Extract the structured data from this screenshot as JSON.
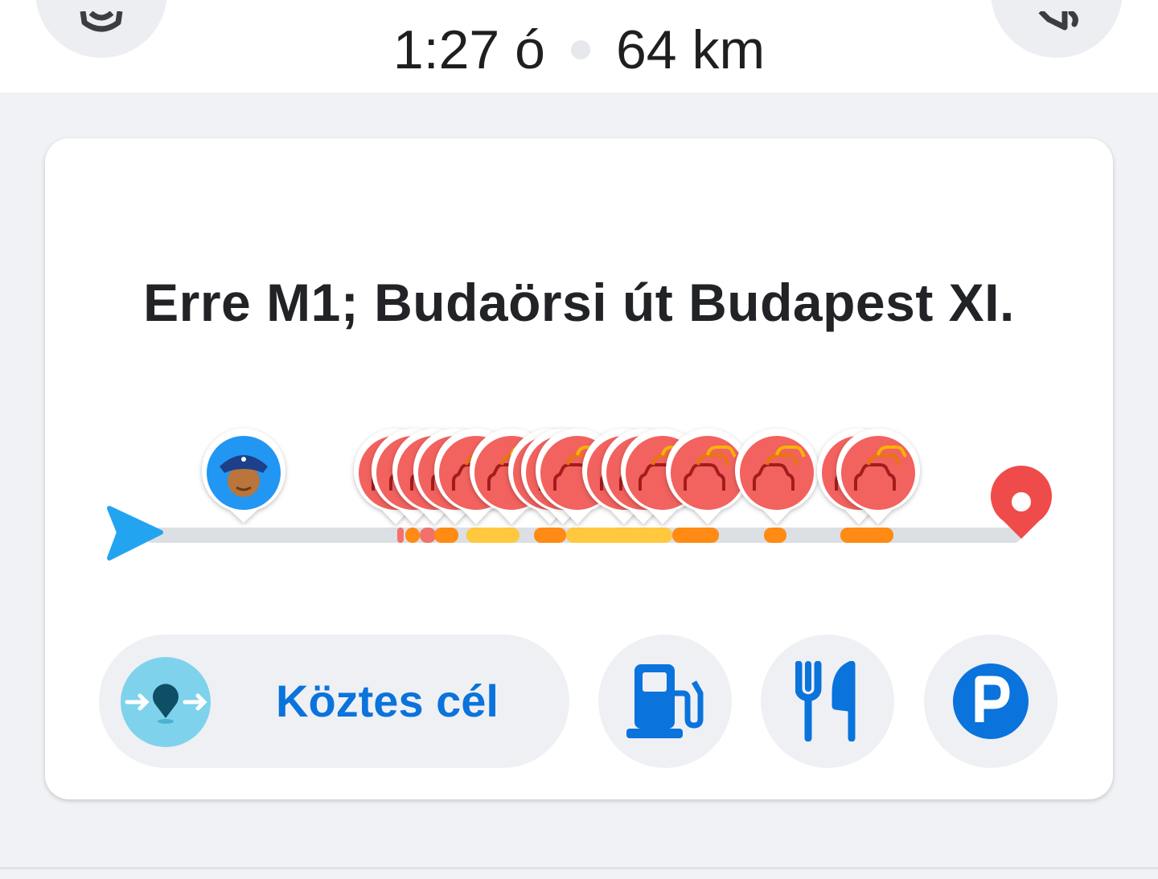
{
  "header": {
    "eta": "1:27 ó",
    "distance": "64 km",
    "left_button_icon": "gear-icon",
    "right_button_icon": "speaker-icon"
  },
  "route": {
    "title": "Erre M1; Budaörsi út Budapest XI.",
    "start_icon": "start-arrow-icon",
    "end_icon": "destination-pin-icon",
    "alerts": [
      {
        "type": "police",
        "icon": "police-officer-icon",
        "color": "#2196f3"
      },
      {
        "type": "traffic-jam",
        "icon": "traffic-jam-icon",
        "color": "#f2625f",
        "count": 14
      }
    ],
    "traffic_colors": {
      "heavy": "#f4706b",
      "moderate": "#ff8a14",
      "light": "#ffc83e",
      "clear": "#dcdfe3"
    }
  },
  "actions": {
    "waypoint_label": "Köztes cél",
    "waypoint_icon": "add-stop-icon",
    "gas_icon": "gas-station-icon",
    "food_icon": "fork-knife-icon",
    "parking_icon": "parking-icon",
    "accent": "#0a73dc"
  }
}
